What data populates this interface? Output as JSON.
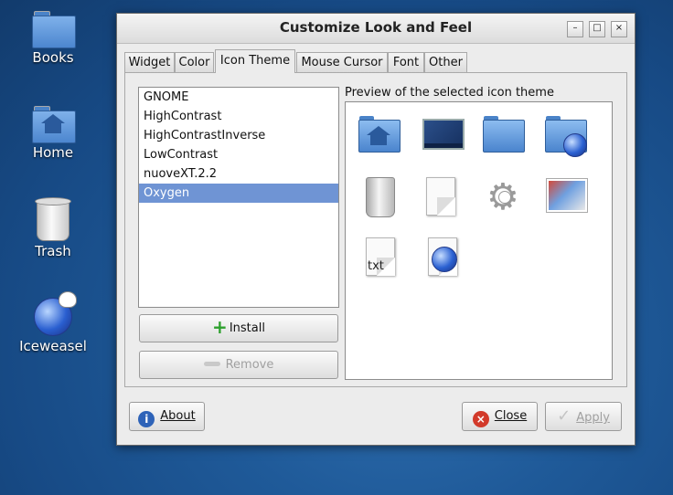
{
  "desktop": {
    "icons": [
      {
        "label": "Books"
      },
      {
        "label": "Home"
      },
      {
        "label": "Trash"
      },
      {
        "label": "Iceweasel"
      }
    ]
  },
  "window": {
    "title": "Customize Look and Feel",
    "controls": {
      "minimize": "–",
      "maximize": "□",
      "close": "×"
    }
  },
  "tabs": [
    {
      "label": "Widget"
    },
    {
      "label": "Color"
    },
    {
      "label": "Icon Theme",
      "active": true
    },
    {
      "label": "Mouse Cursor"
    },
    {
      "label": "Font"
    },
    {
      "label": "Other"
    }
  ],
  "theme_list": {
    "items": [
      "GNOME",
      "HighContrast",
      "HighContrastInverse",
      "LowContrast",
      "nuoveXT.2.2",
      "Oxygen"
    ],
    "selected": "Oxygen"
  },
  "buttons": {
    "install": "Install",
    "remove": "Remove",
    "about": "About",
    "close": "Close",
    "apply": "Apply"
  },
  "preview": {
    "label": "Preview of the selected icon theme",
    "icons": [
      "home-folder-icon",
      "desktop-icon",
      "folder-icon",
      "network-folder-icon",
      "trash-icon",
      "document-icon",
      "settings-gear-icon",
      "image-file-icon",
      "text-file-icon",
      "web-browser-icon"
    ],
    "txt_label": "txt"
  },
  "colors": {
    "selection": "#6f94d4",
    "install_plus": "#2da02d"
  }
}
